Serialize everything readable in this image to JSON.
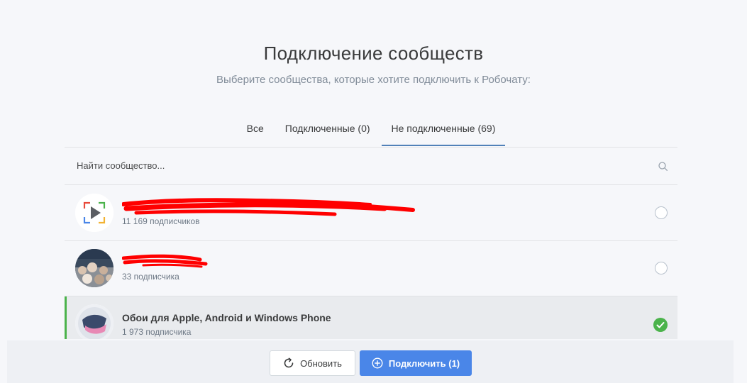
{
  "header": {
    "title": "Подключение сообществ",
    "subtitle": "Выберите сообщества, которые хотите подключить к Робочату:"
  },
  "tabs": [
    {
      "label": "Все",
      "active": false
    },
    {
      "label": "Подключенные (0)",
      "active": false
    },
    {
      "label": "Не подключенные (69)",
      "active": true
    }
  ],
  "search": {
    "placeholder": "Найти сообщество...",
    "value": ""
  },
  "communities": [
    {
      "name": "",
      "subscribers": "11 169 подписчиков",
      "selected": false
    },
    {
      "name": "",
      "subscribers": "33 подписчика",
      "selected": false
    },
    {
      "name": "Обои для Apple, Android и Windows Phone",
      "subscribers": "1 973 подписчика",
      "selected": true
    }
  ],
  "footer": {
    "refresh_label": "Обновить",
    "connect_label": "Подключить (1)"
  },
  "colors": {
    "accent": "#4a86e8",
    "tab_underline": "#5181b8",
    "selected_bar": "#4bb34b",
    "redaction": "#ff0000"
  }
}
